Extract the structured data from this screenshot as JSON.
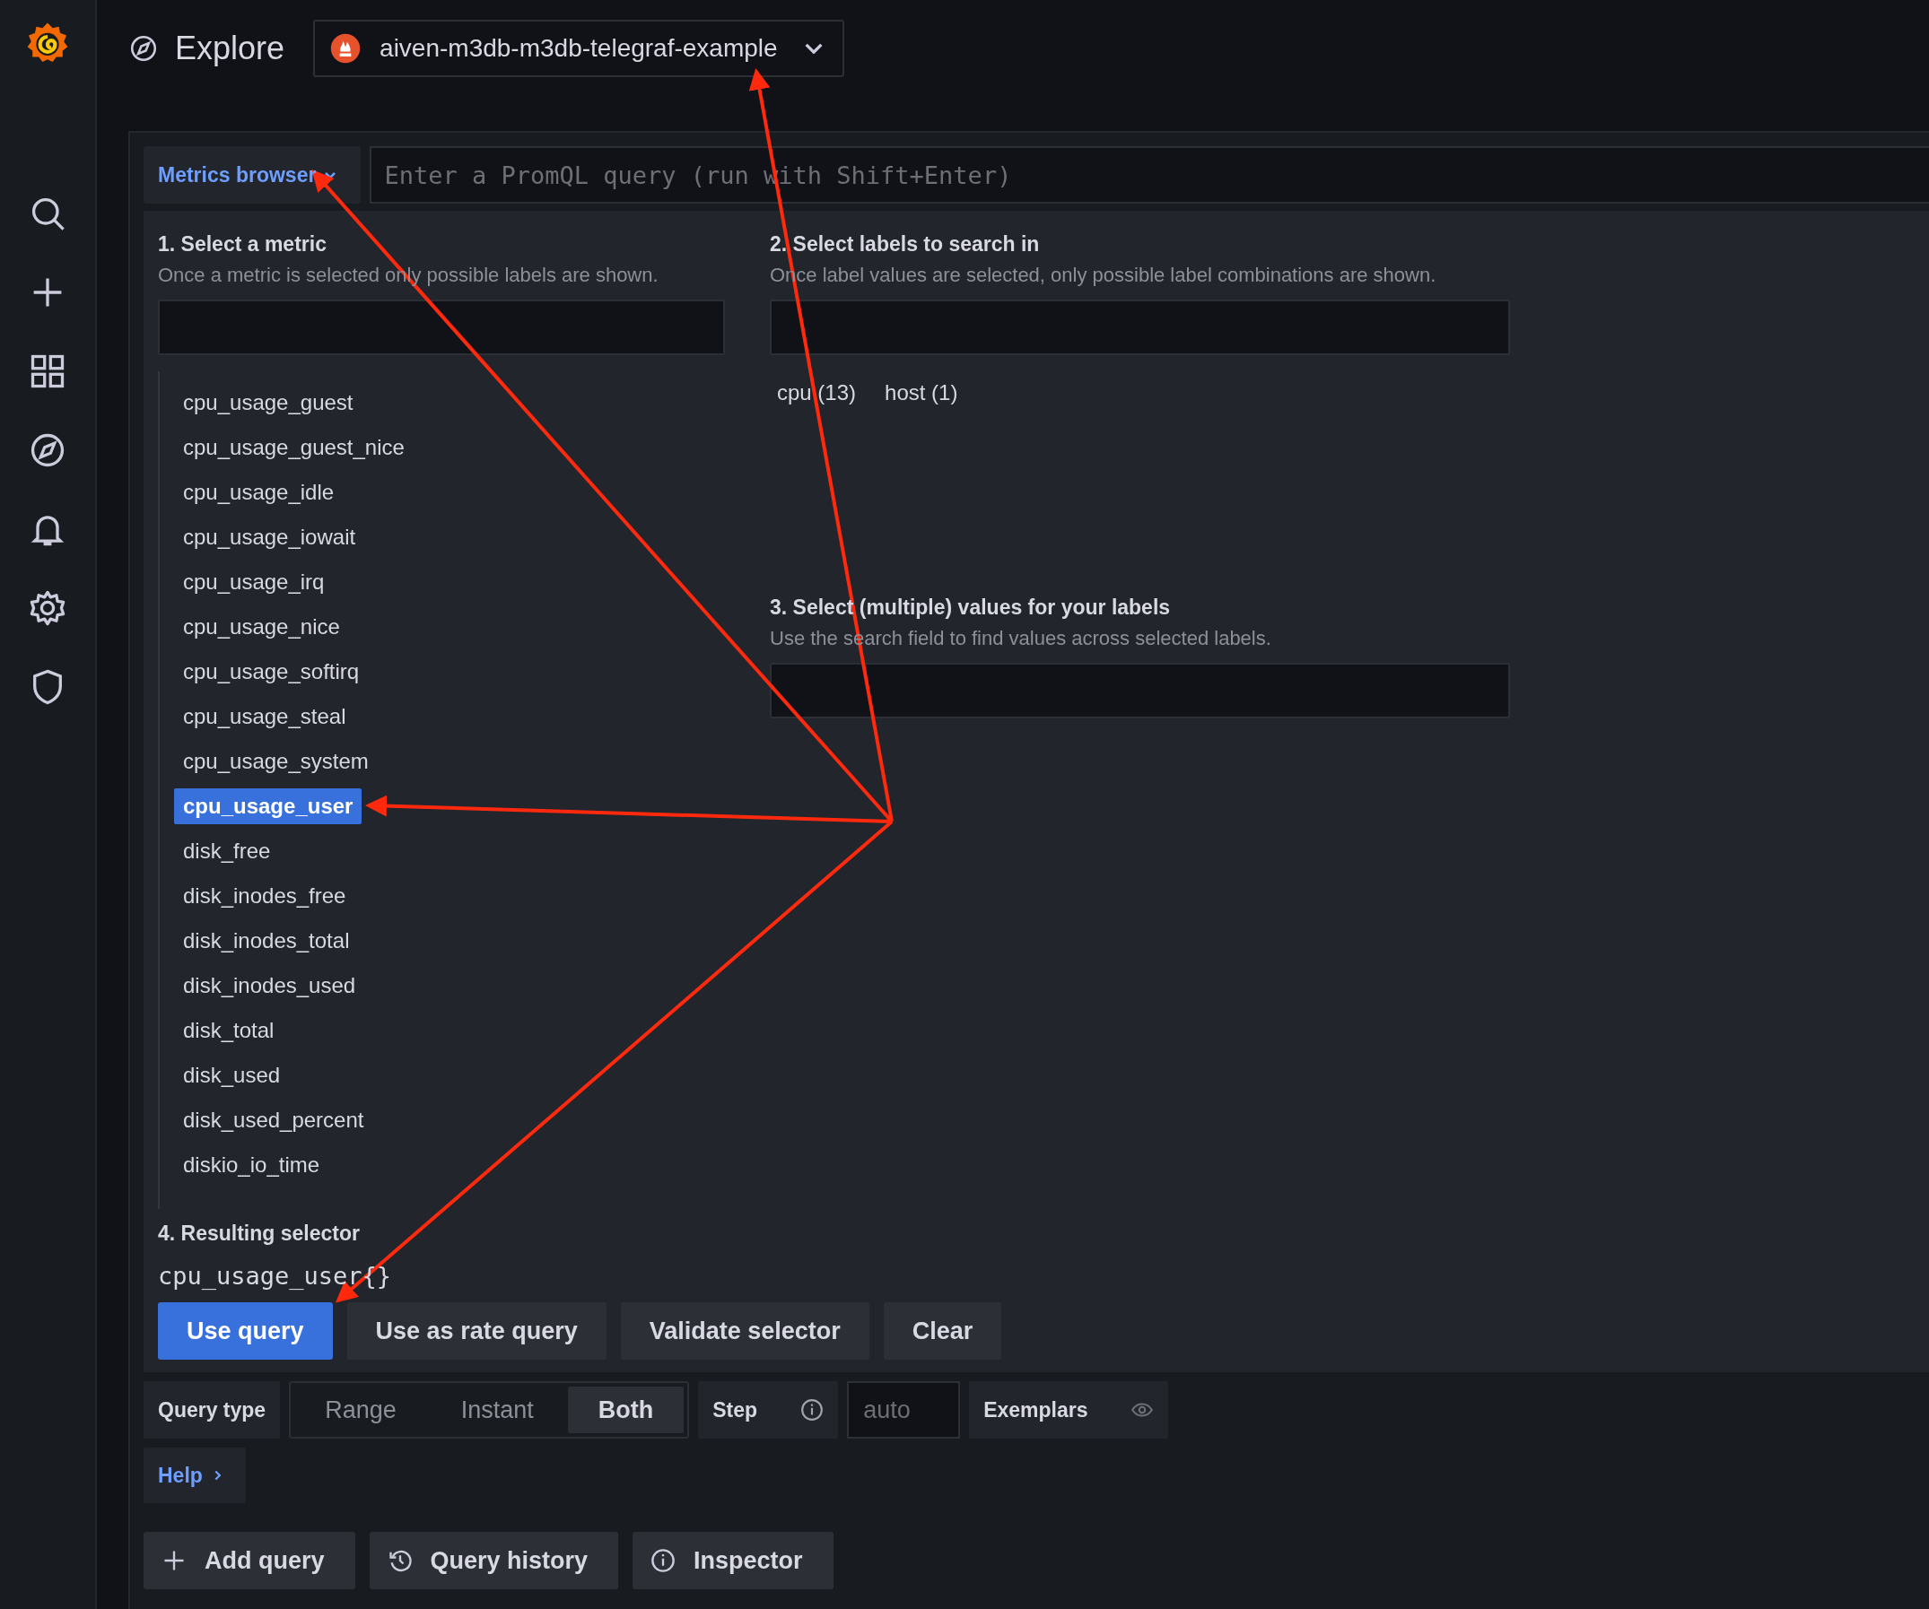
{
  "header": {
    "title": "Explore",
    "datasource": "aiven-m3db-m3db-telegraf-example"
  },
  "query_editor": {
    "mode_button": "Metrics browser",
    "query_placeholder": "Enter a PromQL query (run with Shift+Enter)"
  },
  "metrics_browser": {
    "step1": {
      "title": "1. Select a metric",
      "hint": "Once a metric is selected only possible labels are shown.",
      "metrics": [
        {
          "name": "cpu_usage_guest",
          "selected": false
        },
        {
          "name": "cpu_usage_guest_nice",
          "selected": false
        },
        {
          "name": "cpu_usage_idle",
          "selected": false
        },
        {
          "name": "cpu_usage_iowait",
          "selected": false
        },
        {
          "name": "cpu_usage_irq",
          "selected": false
        },
        {
          "name": "cpu_usage_nice",
          "selected": false
        },
        {
          "name": "cpu_usage_softirq",
          "selected": false
        },
        {
          "name": "cpu_usage_steal",
          "selected": false
        },
        {
          "name": "cpu_usage_system",
          "selected": false
        },
        {
          "name": "cpu_usage_user",
          "selected": true
        },
        {
          "name": "disk_free",
          "selected": false
        },
        {
          "name": "disk_inodes_free",
          "selected": false
        },
        {
          "name": "disk_inodes_total",
          "selected": false
        },
        {
          "name": "disk_inodes_used",
          "selected": false
        },
        {
          "name": "disk_total",
          "selected": false
        },
        {
          "name": "disk_used",
          "selected": false
        },
        {
          "name": "disk_used_percent",
          "selected": false
        },
        {
          "name": "diskio_io_time",
          "selected": false
        }
      ]
    },
    "step2": {
      "title": "2. Select labels to search in",
      "hint": "Once label values are selected, only possible label combinations are shown.",
      "labels": [
        "cpu (13)",
        "host (1)"
      ]
    },
    "step3": {
      "title": "3. Select (multiple) values for your labels",
      "hint": "Use the search field to find values across selected labels."
    },
    "step4": {
      "title": "4. Resulting selector",
      "selector": "cpu_usage_user{}"
    },
    "buttons": [
      {
        "label": "Use query",
        "kind": "primary"
      },
      {
        "label": "Use as rate query",
        "kind": "secondary"
      },
      {
        "label": "Validate selector",
        "kind": "secondary"
      },
      {
        "label": "Clear",
        "kind": "secondary"
      }
    ]
  },
  "options": {
    "query_type_label": "Query type",
    "query_types": [
      {
        "label": "Range",
        "selected": false
      },
      {
        "label": "Instant",
        "selected": false
      },
      {
        "label": "Both",
        "selected": true
      }
    ],
    "step_label": "Step",
    "step_placeholder": "auto",
    "exemplars_label": "Exemplars"
  },
  "help": "Help",
  "footer_buttons": [
    {
      "label": "Add query",
      "kind": "plus"
    },
    {
      "label": "Query history",
      "kind": "history"
    },
    {
      "label": "Inspector",
      "kind": "info"
    }
  ]
}
